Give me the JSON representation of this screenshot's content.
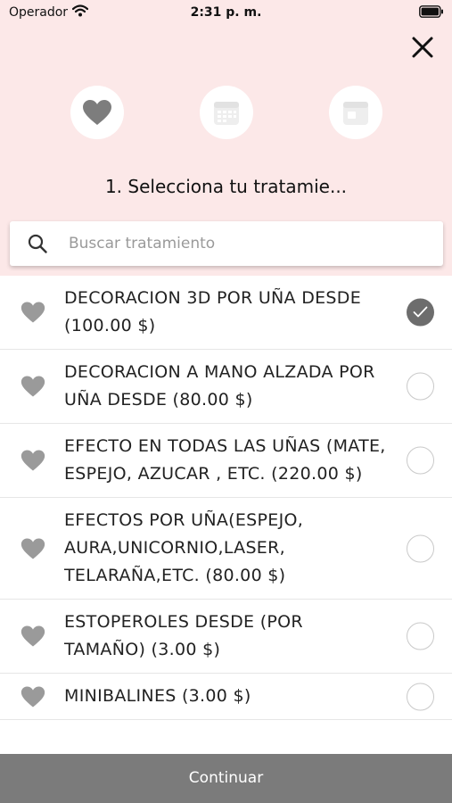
{
  "status_bar": {
    "carrier": "Operador",
    "time": "2:31 p. m."
  },
  "header": {
    "close_icon": "close-icon",
    "steps": [
      {
        "icon": "heart-icon",
        "active": true
      },
      {
        "icon": "calendar-icon",
        "active": false
      },
      {
        "icon": "calendar-day-icon",
        "active": false
      }
    ],
    "step_title": "1. Selecciona tu tratamie..."
  },
  "search": {
    "placeholder": "Buscar tratamiento",
    "value": ""
  },
  "treatments": [
    {
      "label": "DECORACION 3D POR UÑA DESDE (100.00 $)",
      "selected": true
    },
    {
      "label": "DECORACION A MANO ALZADA POR UÑA DESDE (80.00 $)",
      "selected": false
    },
    {
      "label": "EFECTO EN TODAS LAS UÑAS (MATE, ESPEJO, AZUCAR , ETC. (220.00 $)",
      "selected": false
    },
    {
      "label": "EFECTOS POR UÑA(ESPEJO, AURA,UNICORNIO,LASER, TELARAÑA,ETC. (80.00 $)",
      "selected": false
    },
    {
      "label": "ESTOPEROLES DESDE (POR TAMAÑO) (3.00 $)",
      "selected": false
    },
    {
      "label": "MINIBALINES (3.00 $)",
      "selected": false
    }
  ],
  "footer": {
    "continue_label": "Continuar"
  },
  "colors": {
    "header_bg": "#fce8e8",
    "icon_grey": "#9a9a9a",
    "checked": "#6d6d6d",
    "button_bg": "#7b7b7b"
  }
}
